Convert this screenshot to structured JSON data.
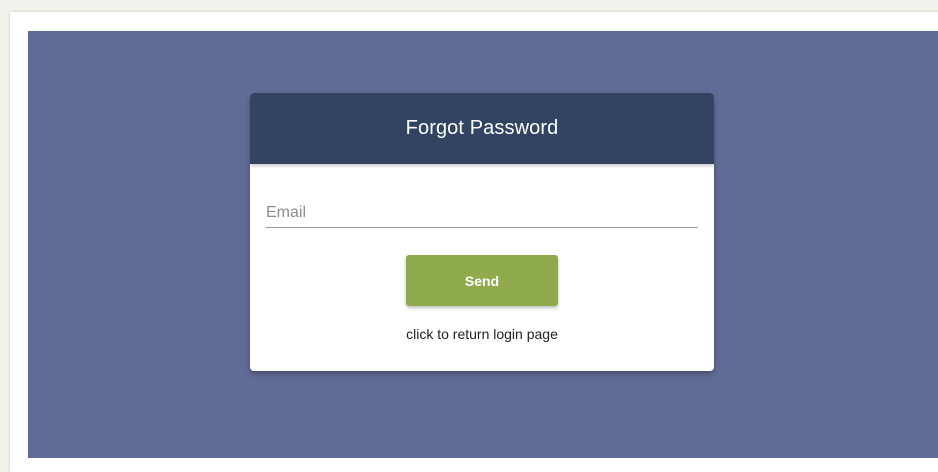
{
  "forgot_password_form": {
    "title": "Forgot Password",
    "email": {
      "value": "",
      "placeholder": "Email"
    },
    "send_label": "Send",
    "return_link_label": "click to return login page"
  },
  "colors": {
    "backdrop": "#616c96",
    "header": "#334462",
    "send_button": "#8fab4d"
  }
}
